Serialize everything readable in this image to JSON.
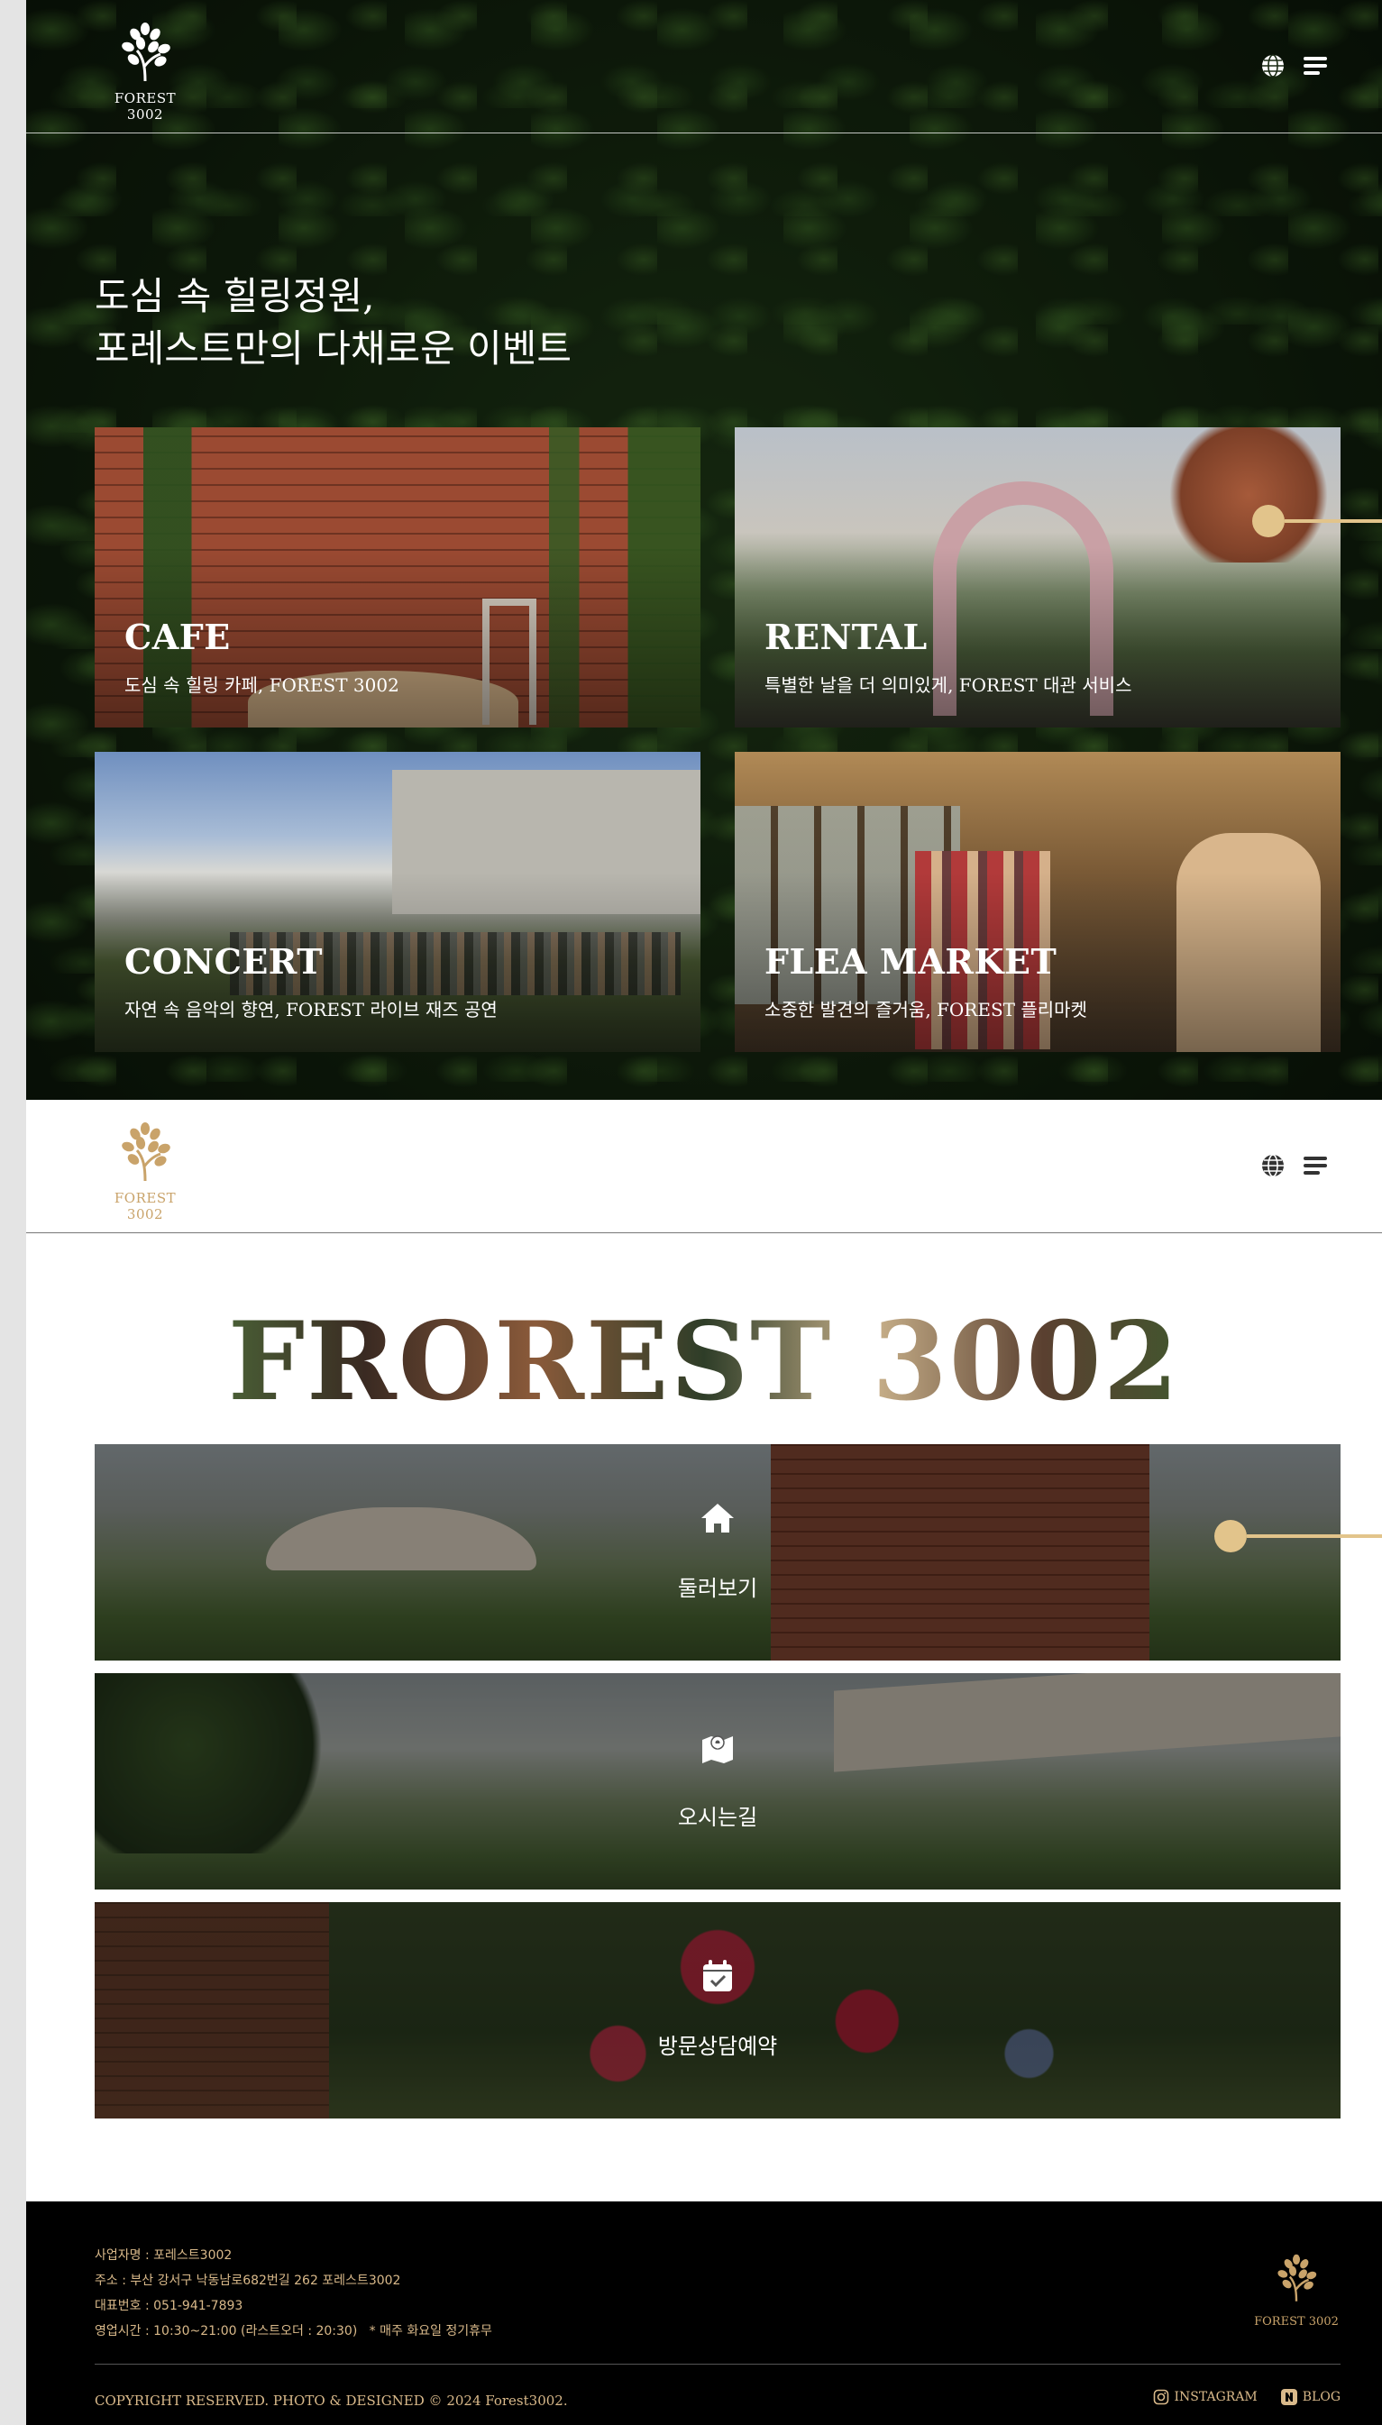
{
  "brand": {
    "name": "FOREST 3002",
    "big_title": "FROREST 3002"
  },
  "hero": {
    "title_line1": "도심 속 힐링정원,",
    "title_line2": "포레스트만의 다채로운 이벤트"
  },
  "cards": [
    {
      "title": "CAFE",
      "subtitle": "도심 속 힐링 카페, FOREST 3002"
    },
    {
      "title": "RENTAL",
      "subtitle": "특별한 날을 더 의미있게, FOREST 대관 서비스"
    },
    {
      "title": "CONCERT",
      "subtitle": "자연 속 음악의 향연, FOREST 라이브 재즈 공연"
    },
    {
      "title": "FLEA MARKET",
      "subtitle": "소중한 발견의 즐거움, FOREST 플리마켓"
    }
  ],
  "tiles": [
    {
      "label": "둘러보기",
      "icon": "home-icon"
    },
    {
      "label": "오시는길",
      "icon": "map-icon"
    },
    {
      "label": "방문상담예약",
      "icon": "calendar-check-icon"
    }
  ],
  "footer": {
    "company": "사업자명 : 포레스트3002",
    "address": "주소 : 부산 강서구 낙동남로682번길 262 포레스트3002",
    "phone": "대표번호 : 051-941-7893",
    "hours": "영업시간 : 10:30~21:00 (라스트오더 : 20:30)",
    "holiday": "* 매주 화요일 정기휴무",
    "copyright": "COPYRIGHT RESERVED. PHOTO & DESIGNED © 2024 Forest3002.",
    "instagram": "INSTAGRAM",
    "blog": "BLOG"
  },
  "colors": {
    "accent": "#e2c48b",
    "gold_text": "#d9b98a",
    "footer_bg": "#000000"
  }
}
